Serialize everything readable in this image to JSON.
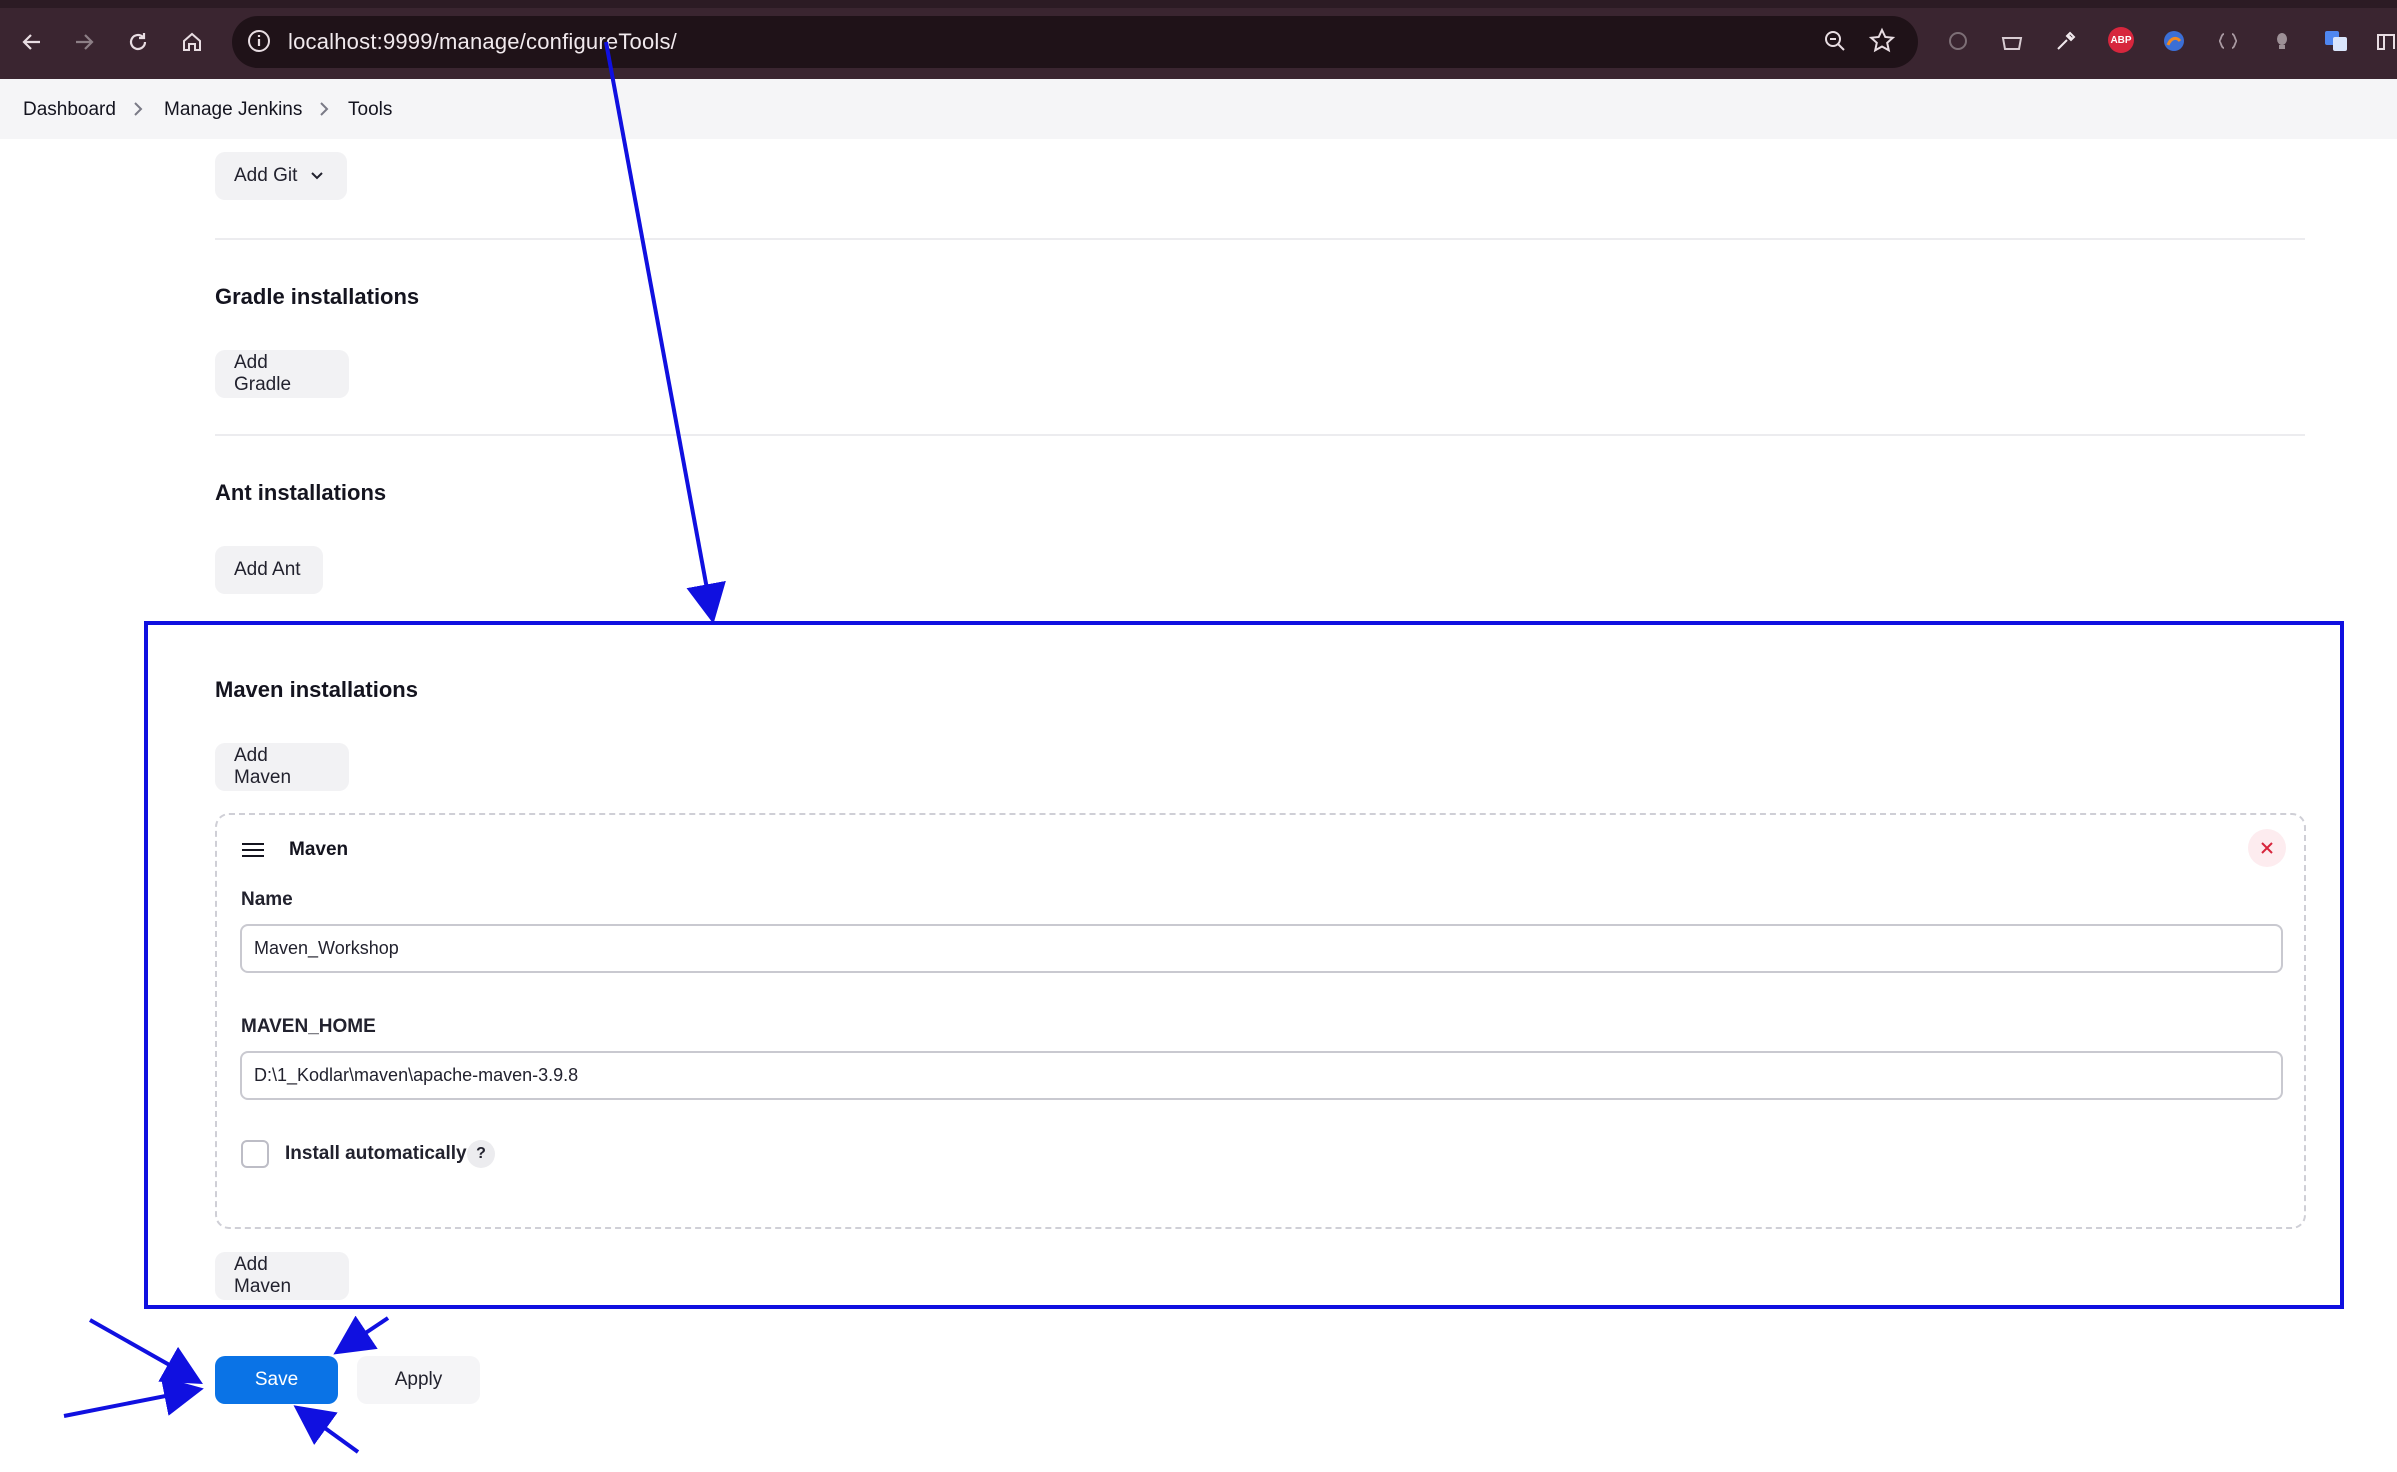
{
  "browser": {
    "url": "localhost:9999/manage/configureTools/",
    "abp_label": "ABP"
  },
  "breadcrumb": {
    "items": [
      "Dashboard",
      "Manage Jenkins",
      "Tools"
    ]
  },
  "git": {
    "add_button": "Add Git"
  },
  "gradle": {
    "title": "Gradle installations",
    "add_button": "Add Gradle"
  },
  "ant": {
    "title": "Ant installations",
    "add_button": "Add Ant"
  },
  "maven": {
    "title": "Maven installations",
    "add_button_top": "Add Maven",
    "add_button_bottom": "Add Maven",
    "card": {
      "title": "Maven",
      "name_label": "Name",
      "name_value": "Maven_Workshop",
      "home_label": "MAVEN_HOME",
      "home_value": "D:\\1_Kodlar\\maven\\apache-maven-3.9.8",
      "install_label": "Install automatically",
      "help_label": "?"
    }
  },
  "actions": {
    "save": "Save",
    "apply": "Apply"
  },
  "colors": {
    "primary": "#0a73e6",
    "annotation": "#1010e0",
    "close": "#d7263d"
  }
}
